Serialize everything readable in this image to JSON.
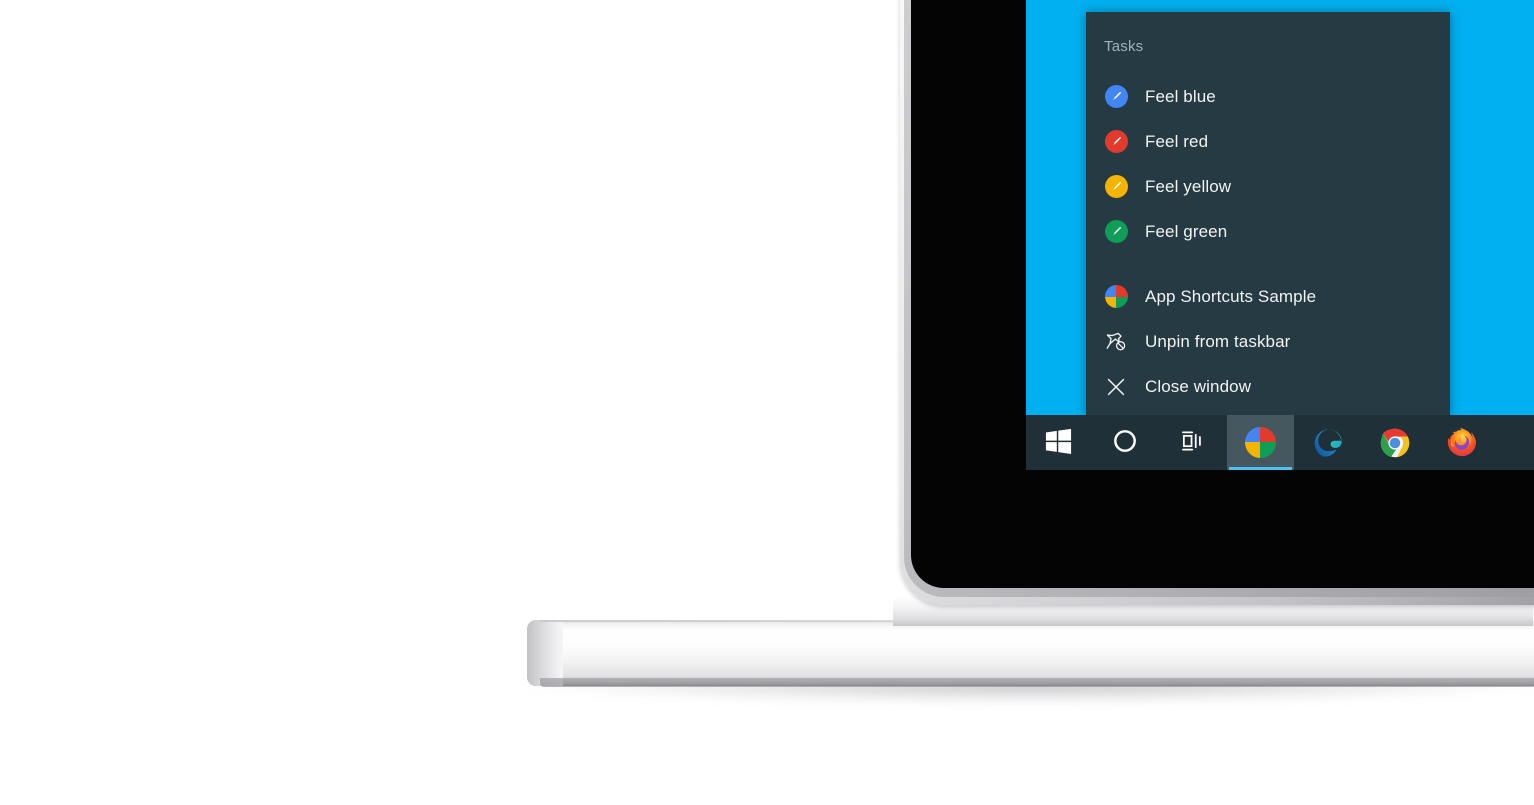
{
  "scene": {
    "description": "windows-jump-list-on-laptop",
    "device_label": "laptop-mockup"
  },
  "colors": {
    "desktop_wallpaper": "#00b0f0",
    "jumplist_background": "#253a42",
    "taskbar_background": "#1f3038",
    "taskbar_active_highlight": "#46585f",
    "taskbar_active_underline": "#4cc2f1",
    "menu_text": "#f2f2f2",
    "menu_header_text": "#9fb2b8",
    "bezel_black": "#040404",
    "laptop_silver": "#e6e6e8"
  },
  "jumplist": {
    "header": "Tasks",
    "tasks": [
      {
        "label": "Feel blue",
        "icon": "paint-blue-icon",
        "color": "#4285f4"
      },
      {
        "label": "Feel red",
        "icon": "paint-red-icon",
        "color": "#e23b2e"
      },
      {
        "label": "Feel yellow",
        "icon": "paint-yellow-icon",
        "color": "#f5b400"
      },
      {
        "label": "Feel green",
        "icon": "paint-green-icon",
        "color": "#0f9d58"
      }
    ],
    "actions": [
      {
        "label": "App Shortcuts Sample",
        "icon": "app-quad-icon"
      },
      {
        "label": "Unpin from taskbar",
        "icon": "unpin-icon"
      },
      {
        "label": "Close window",
        "icon": "close-icon"
      }
    ]
  },
  "taskbar": {
    "items": [
      {
        "name": "start-button",
        "icon": "windows-logo-icon",
        "label": "Start",
        "active": false
      },
      {
        "name": "search-button",
        "icon": "cortana-ring-icon",
        "label": "Search",
        "active": false
      },
      {
        "name": "task-view-button",
        "icon": "task-view-icon",
        "label": "Task View",
        "active": false
      },
      {
        "name": "app-shortcuts-app",
        "icon": "app-quad-icon",
        "label": "App Shortcuts Sample",
        "active": true
      },
      {
        "name": "edge-app",
        "icon": "edge-icon",
        "label": "Microsoft Edge",
        "active": false
      },
      {
        "name": "chrome-app",
        "icon": "chrome-icon",
        "label": "Google Chrome",
        "active": false
      },
      {
        "name": "firefox-app",
        "icon": "firefox-icon",
        "label": "Mozilla Firefox",
        "active": false
      }
    ]
  }
}
